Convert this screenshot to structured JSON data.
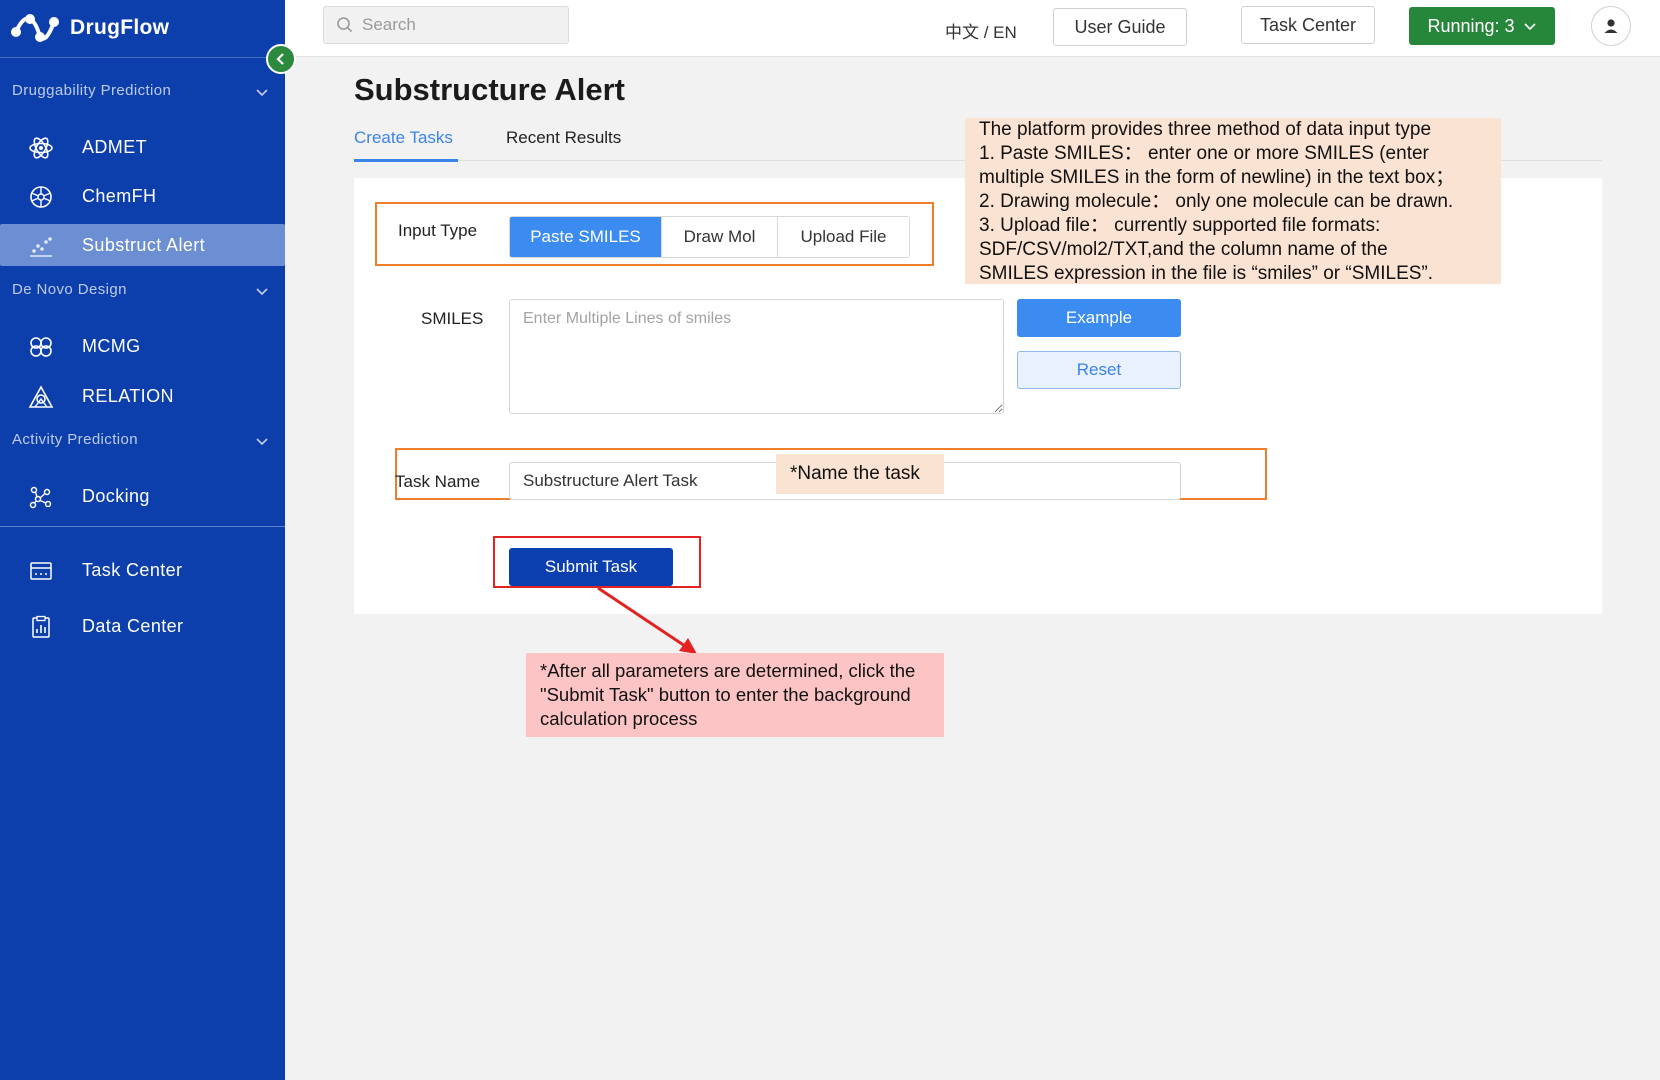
{
  "app": {
    "name": "DrugFlow"
  },
  "sidebar": {
    "groups": [
      {
        "label": "Druggability Prediction"
      },
      {
        "label": "De Novo Design"
      },
      {
        "label": "Activity Prediction"
      }
    ],
    "items": [
      {
        "label": "ADMET",
        "icon": "atom-icon"
      },
      {
        "label": "ChemFH",
        "icon": "wheel-icon"
      },
      {
        "label": "Substruct Alert",
        "icon": "scatter-icon",
        "active": true
      },
      {
        "label": "MCMG",
        "icon": "molecule-icon"
      },
      {
        "label": "RELATION",
        "icon": "relation-icon"
      },
      {
        "label": "Docking",
        "icon": "docking-icon"
      },
      {
        "label": "Task Center",
        "icon": "window-icon"
      },
      {
        "label": "Data Center",
        "icon": "clipboard-chart-icon"
      }
    ]
  },
  "header": {
    "search_placeholder": "Search",
    "language": "中文 / EN",
    "user_guide": "User Guide",
    "task_center": "Task Center",
    "running": "Running: 3"
  },
  "main": {
    "title": "Substructure Alert",
    "tabs": [
      {
        "label": "Create Tasks",
        "active": true
      },
      {
        "label": "Recent Results"
      }
    ],
    "form": {
      "input_type_label": "Input Type",
      "input_type_options": [
        "Paste SMILES",
        "Draw Mol",
        "Upload File"
      ],
      "input_type_selected": "Paste SMILES",
      "smiles_label": "SMILES",
      "smiles_placeholder": "Enter Multiple Lines of smiles",
      "example_button": "Example",
      "reset_button": "Reset",
      "task_name_label": "Task Name",
      "task_name_value": "Substructure Alert Task",
      "submit_button": "Submit Task"
    }
  },
  "annotations": {
    "input_type_note": [
      "The platform provides three method of data input type",
      "1. Paste SMILES： enter one or more SMILES (enter",
      "multiple SMILES in the form of newline) in the text box；",
      "2. Drawing molecule： only one molecule can be drawn.",
      "3. Upload file： currently supported file formats:",
      "SDF/CSV/mol2/TXT,and the column name of the",
      "SMILES expression in the file is “smiles” or “SMILES”."
    ],
    "task_name_note": "*Name the task",
    "submit_note": "*After all parameters are determined, click the \"Submit Task\" button to enter the background calculation process"
  },
  "colors": {
    "sidebar": "#0c3fac",
    "accent": "#3b8bf0",
    "running": "#26873b",
    "callout_orange": "#f07d2a",
    "callout_red": "#e32222"
  }
}
